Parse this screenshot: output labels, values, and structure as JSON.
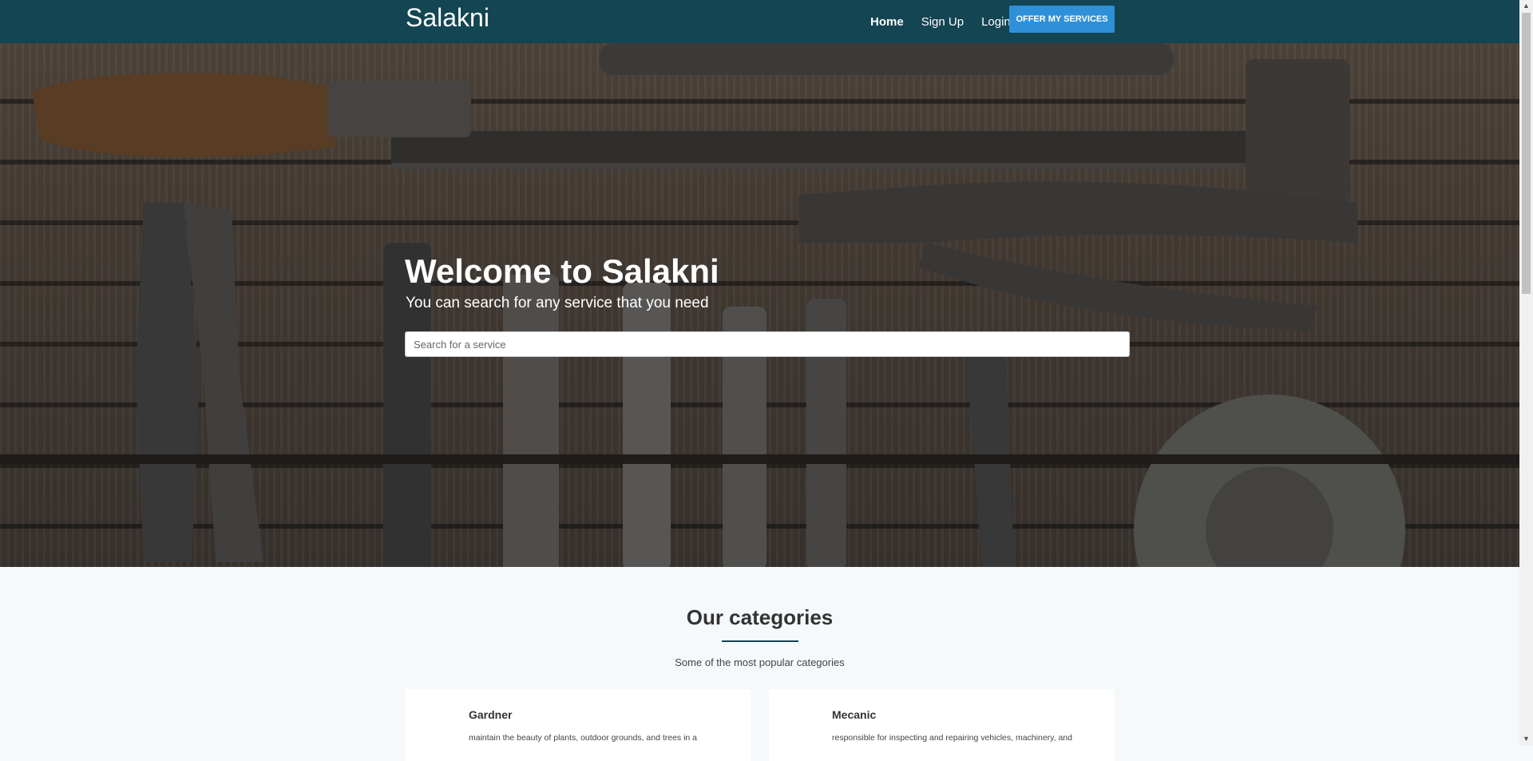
{
  "navbar": {
    "brand": "Salakni",
    "links": [
      "Home",
      "Sign Up",
      "Login"
    ],
    "offer_button": "OFFER MY SERVICES"
  },
  "hero": {
    "title": "Welcome to Salakni",
    "subtitle": "You can search for any service that you need",
    "search_placeholder": "Search for a service"
  },
  "categories": {
    "title": "Our categories",
    "subtitle": "Some of the most popular categories",
    "items": [
      {
        "name": "Gardner",
        "description": "maintain the beauty of plants, outdoor grounds, and trees in a"
      },
      {
        "name": "Mecanic",
        "description": "responsible for inspecting and repairing vehicles, machinery, and"
      }
    ]
  },
  "colors": {
    "navbar": "#134552",
    "accent": "#2e90d9",
    "page_bg": "#f5f9fc"
  },
  "icons": [
    "scroll-up-arrow-icon",
    "scroll-down-arrow-icon"
  ]
}
